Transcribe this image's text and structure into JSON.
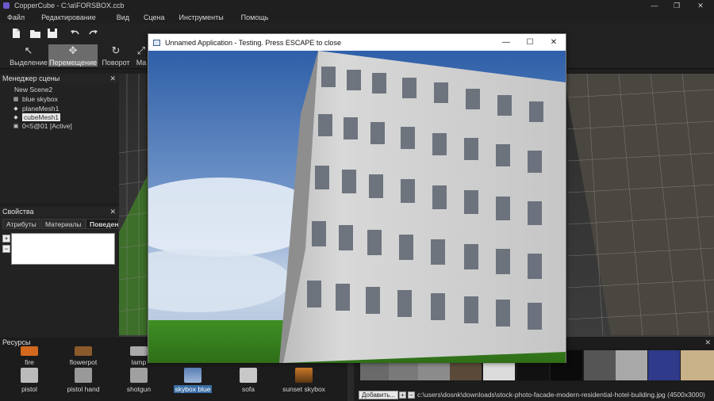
{
  "window": {
    "title": "CopperCube - C:\\a\\FORSBOX.ccb",
    "controls": {
      "minimize": "—",
      "maximize": "❐",
      "close": "✕"
    }
  },
  "menu": [
    "Файл",
    "Редактирование",
    "Вид",
    "Сцена",
    "Инструменты",
    "Помощь"
  ],
  "toolbar": {
    "icons": [
      "new-file",
      "open-folder",
      "save",
      "undo",
      "redo"
    ],
    "tools": [
      {
        "label": "Выделение",
        "icon": "↖"
      },
      {
        "label": "Перемещение",
        "icon": "✥"
      },
      {
        "label": "Поворот",
        "icon": "↻"
      },
      {
        "label": "Ма",
        "icon": "⤢"
      }
    ],
    "active_tool": "Перемещение"
  },
  "scene_panel": {
    "title": "Менеджер сцены",
    "close": "✕",
    "items": [
      {
        "label": "New Scene2",
        "icon": ""
      },
      {
        "label": "blue skybox",
        "icon": "▦"
      },
      {
        "label": "planeMesh1",
        "icon": "◆"
      },
      {
        "label": "cubeMesh1",
        "icon": "◆",
        "selected": true
      },
      {
        "label": "0<5@01 [Active]",
        "icon": "▣"
      }
    ]
  },
  "properties_panel": {
    "title": "Свойства",
    "close": "✕",
    "tabs": [
      "Атрибуты",
      "Материалы",
      "Поведен"
    ],
    "active_tab": "Поведен",
    "add_button": "+",
    "remove_button": "−"
  },
  "resources_panel": {
    "title": "Ресурсы",
    "close": "✕",
    "items": [
      {
        "label": "fire",
        "color": "#d2691e"
      },
      {
        "label": "flowerpot",
        "color": "#8b5a2b"
      },
      {
        "label": "lamp",
        "color": "#aaaaaa"
      },
      {
        "label": "pistol",
        "color": "#bbbbbb"
      },
      {
        "label": "pistol hand",
        "color": "#999999"
      },
      {
        "label": "shotgun",
        "color": "#a0a0a0"
      },
      {
        "label": "skybox blue",
        "color": "#5a7fb5",
        "selected": true
      },
      {
        "label": "sofa",
        "color": "#c8c8c8"
      },
      {
        "label": "sunset skybox",
        "color": "#c97a2a"
      }
    ],
    "add_button": "Добавить...",
    "texture_path": "c:\\users\\dosnk\\downloads\\stock-photo-facade-modern-residential-hotel-building.jpg (4500x3000)"
  },
  "test_window": {
    "title": "Unnamed Application - Testing. Press ESCAPE to close",
    "controls": {
      "minimize": "—",
      "maximize": "☐",
      "close": "✕"
    }
  },
  "colors": {
    "accent_selected": "#3a6ea5",
    "active_tool_bg": "#6c6c6c",
    "sky_top": "#2f5fa8",
    "grass": "#3f8f24"
  }
}
